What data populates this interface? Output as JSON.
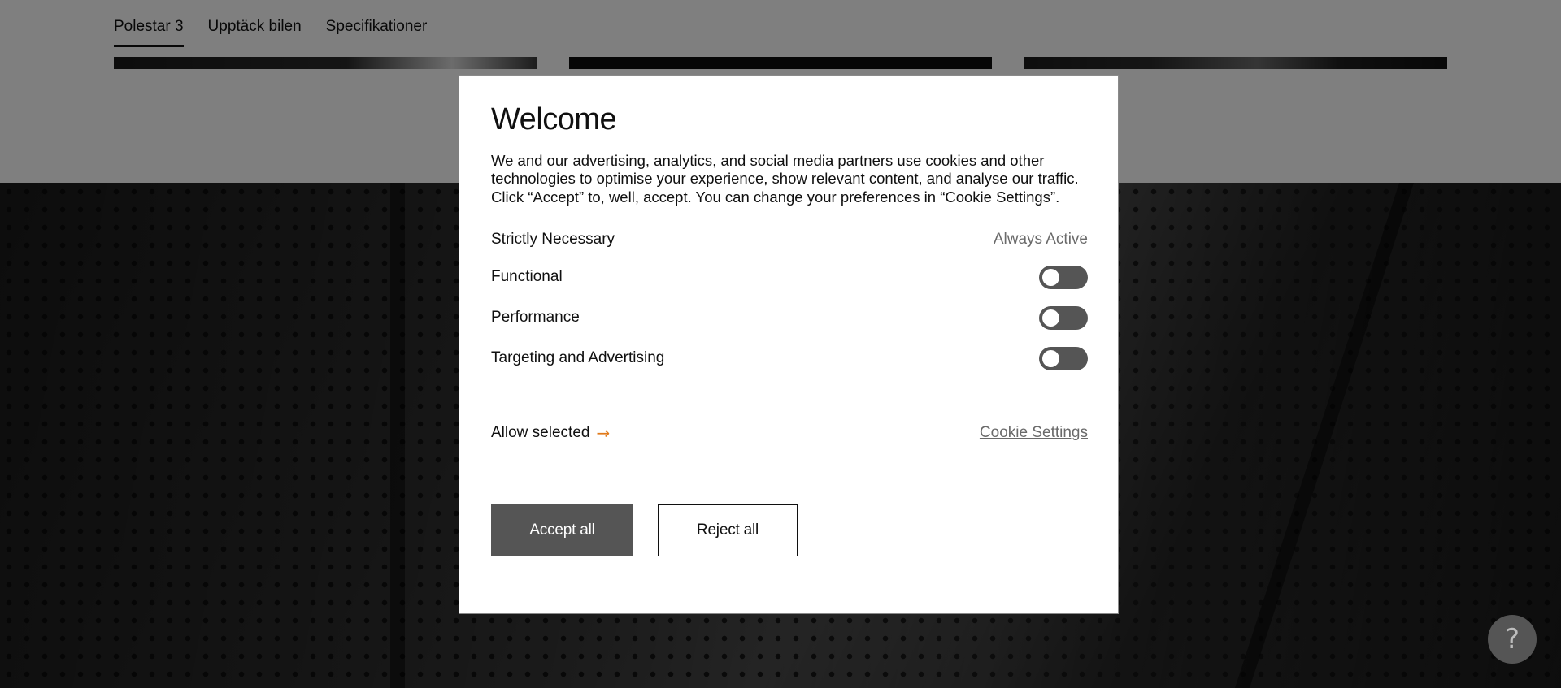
{
  "subnav": {
    "items": [
      {
        "label": "Polestar 3",
        "active": true
      },
      {
        "label": "Upptäck bilen",
        "active": false
      },
      {
        "label": "Specifikationer",
        "active": false
      }
    ]
  },
  "modal": {
    "title": "Welcome",
    "text": "We and our advertising, analytics, and social media partners use cookies and other technologies to optimise your experience, show relevant content, and analyse our traffic. Click “Accept” to, well, accept. You can change your preferences in “Cookie Settings”.",
    "preferences": [
      {
        "label": "Strictly Necessary",
        "status": "Always Active"
      },
      {
        "label": "Functional",
        "enabled": false
      },
      {
        "label": "Performance",
        "enabled": false
      },
      {
        "label": "Targeting and Advertising",
        "enabled": false
      }
    ],
    "allow_selected_label": "Allow selected",
    "cookie_settings_label": "Cookie Settings",
    "accept_all_label": "Accept all",
    "reject_all_label": "Reject all"
  },
  "help": {
    "glyph": "?"
  },
  "colors": {
    "accent_arrow": "#e07a1a",
    "toggle_off": "#555555",
    "accept_button": "#555555"
  }
}
